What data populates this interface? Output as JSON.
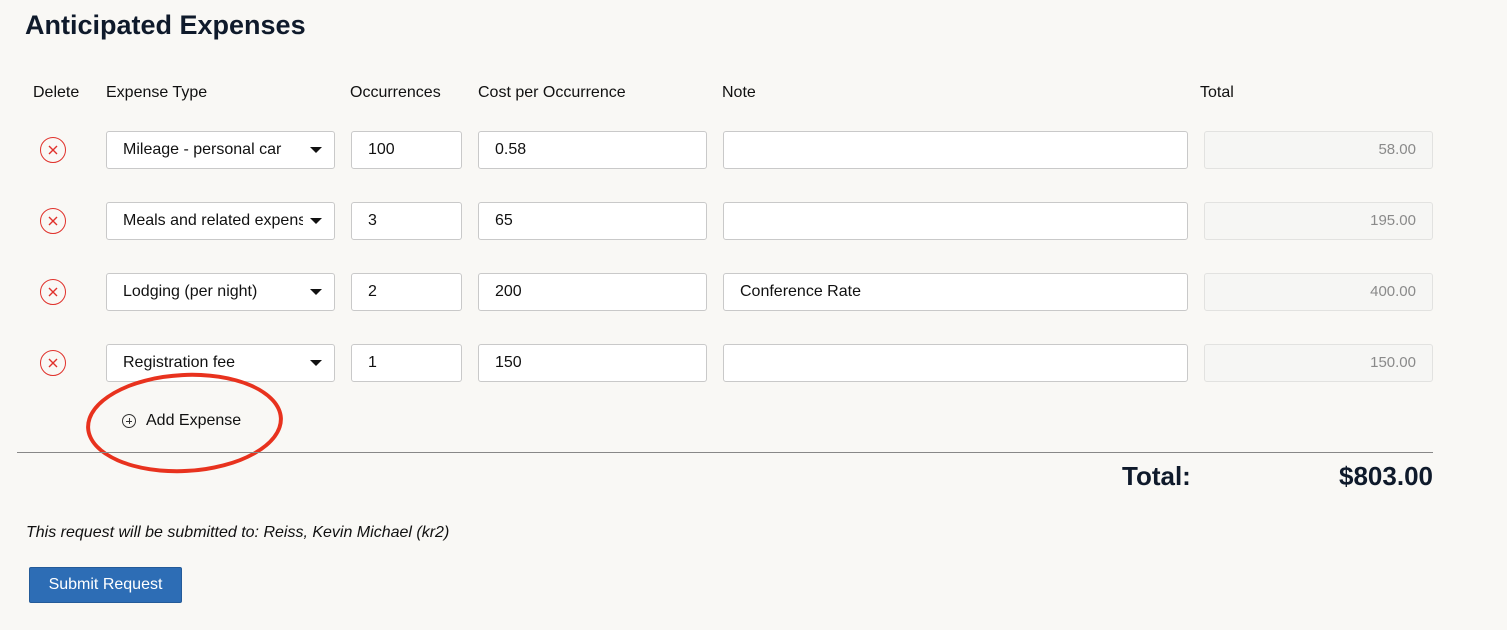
{
  "page_title": "Anticipated Expenses",
  "columns": {
    "delete": "Delete",
    "expense_type": "Expense Type",
    "occurrences": "Occurrences",
    "cost": "Cost per Occurrence",
    "note": "Note",
    "total": "Total"
  },
  "rows": [
    {
      "type": "Mileage - personal car",
      "occurrences": "100",
      "cost": "0.58",
      "note": "",
      "total": "58.00"
    },
    {
      "type": "Meals and related expenses",
      "occurrences": "3",
      "cost": "65",
      "note": "",
      "total": "195.00"
    },
    {
      "type": "Lodging (per night)",
      "occurrences": "2",
      "cost": "200",
      "note": "Conference Rate",
      "total": "400.00"
    },
    {
      "type": "Registration fee",
      "occurrences": "1",
      "cost": "150",
      "note": "",
      "total": "150.00"
    }
  ],
  "add_expense_label": "Add Expense",
  "grand_total": {
    "label": "Total:",
    "value": "$803.00"
  },
  "submit_note": "This request will be submitted to: Reiss, Kevin Michael (kr2)",
  "submit_button": "Submit Request",
  "colors": {
    "accent_button": "#2d6db5",
    "delete_icon": "#e0312b",
    "highlight_annotation": "#e8321e",
    "background": "#f9f8f5"
  },
  "icons": {
    "delete": "circle-x-icon",
    "add": "circle-plus-icon",
    "select": "caret-down-icon"
  }
}
